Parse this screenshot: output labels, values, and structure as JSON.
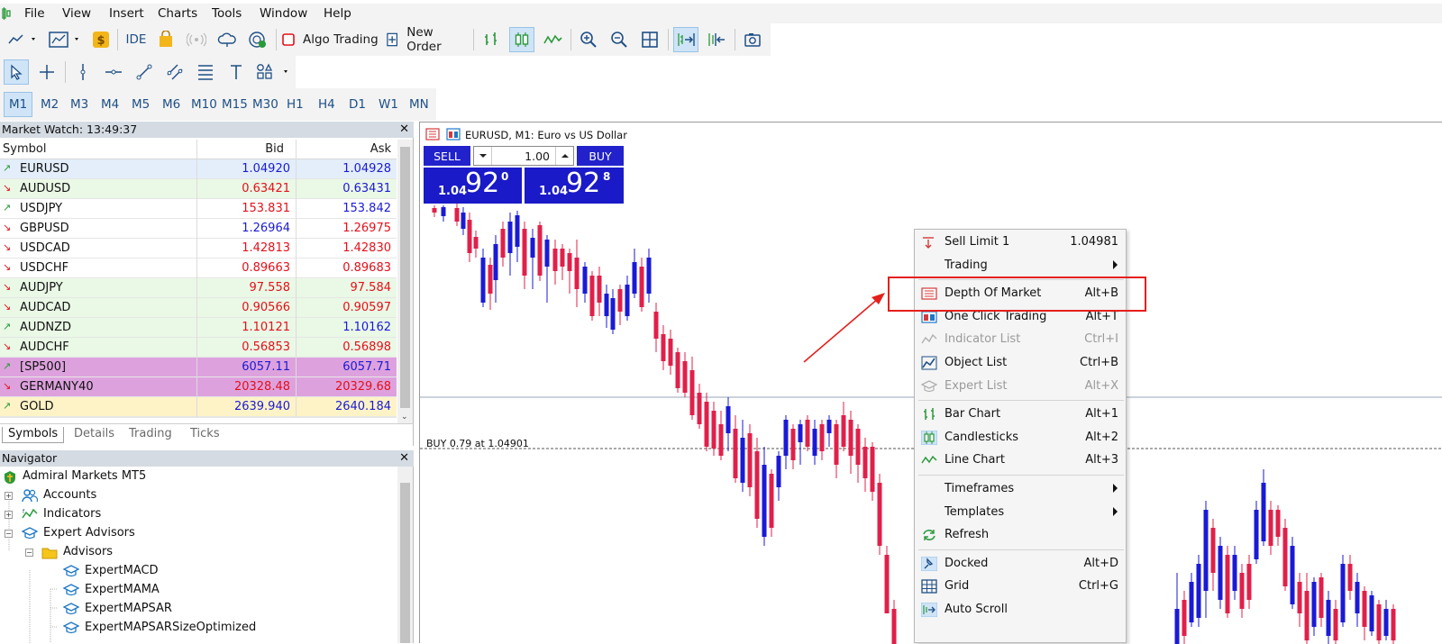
{
  "menubar": {
    "items": [
      "File",
      "View",
      "Insert",
      "Charts",
      "Tools",
      "Window",
      "Help"
    ]
  },
  "toolbar": {
    "ide_label": "IDE",
    "algo_trading_label": "Algo Trading",
    "new_order_label": "New Order"
  },
  "timeframes": [
    "M1",
    "M2",
    "M3",
    "M4",
    "M5",
    "M6",
    "M10",
    "M15",
    "M30",
    "H1",
    "H4",
    "D1",
    "W1",
    "MN"
  ],
  "market_watch": {
    "title": "Market Watch: 13:49:37",
    "columns": {
      "symbol": "Symbol",
      "bid": "Bid",
      "ask": "Ask"
    },
    "rows": [
      {
        "symbol": "EURUSD",
        "bid": "1.04920",
        "ask": "1.04928",
        "dir": "up",
        "bg": "#e3eefa",
        "bid_color": "#1a1ad6",
        "ask_color": "#1a1ad6"
      },
      {
        "symbol": "AUDUSD",
        "bid": "0.63421",
        "ask": "0.63431",
        "dir": "down",
        "bg": "#eaf8e6",
        "bid_color": "#e5101a",
        "ask_color": "#1a1ad6"
      },
      {
        "symbol": "USDJPY",
        "bid": "153.831",
        "ask": "153.842",
        "dir": "up",
        "bg": "#ffffff",
        "bid_color": "#e5101a",
        "ask_color": "#1a1ad6"
      },
      {
        "symbol": "GBPUSD",
        "bid": "1.26964",
        "ask": "1.26975",
        "dir": "down",
        "bg": "#ffffff",
        "bid_color": "#1a1ad6",
        "ask_color": "#e5101a"
      },
      {
        "symbol": "USDCAD",
        "bid": "1.42813",
        "ask": "1.42830",
        "dir": "down",
        "bg": "#ffffff",
        "bid_color": "#e5101a",
        "ask_color": "#e5101a"
      },
      {
        "symbol": "USDCHF",
        "bid": "0.89663",
        "ask": "0.89683",
        "dir": "down",
        "bg": "#ffffff",
        "bid_color": "#e5101a",
        "ask_color": "#e5101a"
      },
      {
        "symbol": "AUDJPY",
        "bid": "97.558",
        "ask": "97.584",
        "dir": "down",
        "bg": "#eaf8e6",
        "bid_color": "#e5101a",
        "ask_color": "#e5101a"
      },
      {
        "symbol": "AUDCAD",
        "bid": "0.90566",
        "ask": "0.90597",
        "dir": "down",
        "bg": "#eaf8e6",
        "bid_color": "#e5101a",
        "ask_color": "#e5101a"
      },
      {
        "symbol": "AUDNZD",
        "bid": "1.10121",
        "ask": "1.10162",
        "dir": "up",
        "bg": "#eaf8e6",
        "bid_color": "#e5101a",
        "ask_color": "#1a1ad6"
      },
      {
        "symbol": "AUDCHF",
        "bid": "0.56853",
        "ask": "0.56898",
        "dir": "down",
        "bg": "#eaf8e6",
        "bid_color": "#e5101a",
        "ask_color": "#e5101a"
      },
      {
        "symbol": "[SP500]",
        "bid": "6057.11",
        "ask": "6057.71",
        "dir": "up",
        "bg": "#dda2dd",
        "bid_color": "#1a1ad6",
        "ask_color": "#1a1ad6"
      },
      {
        "symbol": "GERMANY40",
        "bid": "20328.48",
        "ask": "20329.68",
        "dir": "down",
        "bg": "#dda2dd",
        "bid_color": "#e5101a",
        "ask_color": "#e5101a"
      },
      {
        "symbol": "GOLD",
        "bid": "2639.940",
        "ask": "2640.184",
        "dir": "up",
        "bg": "#fdf3c6",
        "bid_color": "#1a1ad6",
        "ask_color": "#1a1ad6"
      }
    ],
    "tabs": [
      "Symbols",
      "Details",
      "Trading",
      "Ticks"
    ]
  },
  "navigator": {
    "title": "Navigator",
    "items": [
      {
        "label": "Admiral Markets MT5",
        "level": 0
      },
      {
        "label": "Accounts",
        "level": 1
      },
      {
        "label": "Indicators",
        "level": 1
      },
      {
        "label": "Expert Advisors",
        "level": 1
      },
      {
        "label": "Advisors",
        "level": 2
      },
      {
        "label": "ExpertMACD",
        "level": 3
      },
      {
        "label": "ExpertMAMA",
        "level": 3
      },
      {
        "label": "ExpertMAPSAR",
        "level": 3
      },
      {
        "label": "ExpertMAPSARSizeOptimized",
        "level": 3
      }
    ]
  },
  "chart": {
    "title": "EURUSD, M1:  Euro vs US Dollar",
    "one_click": {
      "sell_label": "SELL",
      "buy_label": "BUY",
      "volume": "1.00",
      "sell_small": "1.04",
      "sell_big": "92",
      "sell_sup": "0",
      "buy_small": "1.04",
      "buy_big": "92",
      "buy_sup": "8"
    },
    "buy_line_label": "BUY 0.79 at 1.04901",
    "bull_color": "#1a1ad6",
    "bear_color": "#e0204a"
  },
  "context_menu": {
    "items": [
      {
        "label": "Sell Limit 1",
        "shortcut": "1.04981",
        "icon": "sell-limit-icon",
        "disabled": false,
        "submenu": false
      },
      {
        "label": "Trading",
        "shortcut": "",
        "icon": "",
        "disabled": false,
        "submenu": true
      },
      {
        "label": "Depth Of Market",
        "shortcut": "Alt+B",
        "icon": "depth-of-market-icon",
        "disabled": false,
        "submenu": false
      },
      {
        "label": "One Click Trading",
        "shortcut": "Alt+T",
        "icon": "one-click-trading-icon",
        "disabled": false,
        "submenu": false
      },
      {
        "label": "Indicator List",
        "shortcut": "Ctrl+I",
        "icon": "indicator-list-icon",
        "disabled": true,
        "submenu": false
      },
      {
        "label": "Object List",
        "shortcut": "Ctrl+B",
        "icon": "object-list-icon",
        "disabled": false,
        "submenu": false
      },
      {
        "label": "Expert List",
        "shortcut": "Alt+X",
        "icon": "expert-list-icon",
        "disabled": true,
        "submenu": false
      },
      {
        "label": "Bar Chart",
        "shortcut": "Alt+1",
        "icon": "bar-chart-icon",
        "disabled": false,
        "submenu": false
      },
      {
        "label": "Candlesticks",
        "shortcut": "Alt+2",
        "icon": "candlesticks-icon",
        "disabled": false,
        "submenu": false
      },
      {
        "label": "Line Chart",
        "shortcut": "Alt+3",
        "icon": "line-chart-icon",
        "disabled": false,
        "submenu": false
      },
      {
        "label": "Timeframes",
        "shortcut": "",
        "icon": "",
        "disabled": false,
        "submenu": true
      },
      {
        "label": "Templates",
        "shortcut": "",
        "icon": "",
        "disabled": false,
        "submenu": true
      },
      {
        "label": "Refresh",
        "shortcut": "",
        "icon": "refresh-icon",
        "disabled": false,
        "submenu": false
      },
      {
        "label": "Docked",
        "shortcut": "Alt+D",
        "icon": "docked-icon",
        "disabled": false,
        "submenu": false
      },
      {
        "label": "Grid",
        "shortcut": "Ctrl+G",
        "icon": "grid-icon",
        "disabled": false,
        "submenu": false
      },
      {
        "label": "Auto Scroll",
        "shortcut": "",
        "icon": "auto-scroll-icon",
        "disabled": false,
        "submenu": false
      }
    ]
  },
  "annotation": {
    "color": "#e4201c"
  }
}
